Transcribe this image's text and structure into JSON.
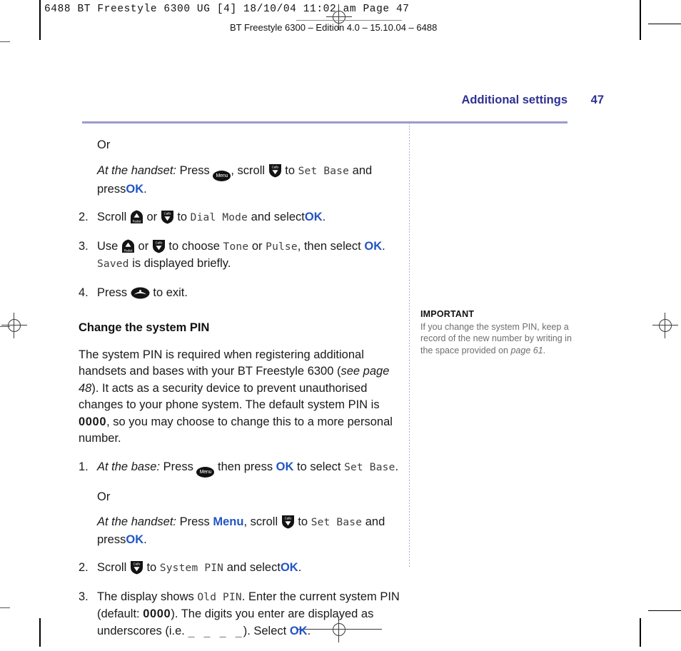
{
  "print_marks": {
    "slug": "6488 BT Freestyle 6300 UG [4]  18/10/04  11:02 am  Page 47",
    "edition_line": "BT Freestyle 6300 – Edition 4.0 – 15.10.04 – 6488"
  },
  "running_head": {
    "title": "Additional settings",
    "folio": "47"
  },
  "main": {
    "or_1": "Or",
    "handset_1": {
      "lead": "At the handset:",
      "t1": "Press",
      "icon_menu": "menu-key-icon",
      "t2": ", scroll",
      "icon_scroll_down": "scroll-down-key-icon",
      "t3": "to",
      "lcd": "Set Base",
      "t4": "and press",
      "ok": "OK",
      "t5": "."
    },
    "step_2": {
      "number": "2.",
      "t1": "Scroll",
      "icon_scroll_up": "scroll-up-key-icon",
      "t2": "or",
      "icon_scroll_down": "scroll-down-key-icon",
      "t3": "to",
      "lcd": "Dial Mode",
      "t4": "and select",
      "ok": "OK",
      "t5": "."
    },
    "step_3": {
      "number": "3.",
      "t1": "Use",
      "icon_scroll_up": "scroll-up-key-icon",
      "t2": "or",
      "icon_scroll_down": "scroll-down-key-icon",
      "t3": "to choose",
      "lcd_tone": "Tone",
      "t4": "or",
      "lcd_pulse": "Pulse",
      "t5": ", then select",
      "ok": "OK",
      "t6": ".",
      "lcd_saved": "Saved",
      "t7": "is displayed briefly."
    },
    "step_4": {
      "number": "4.",
      "t1": "Press",
      "icon_end": "end-call-key-icon",
      "t2": "to exit."
    },
    "section_heading": "Change the system PIN",
    "intro": {
      "t1": "The system PIN is required when registering additional handsets and bases with your BT Freestyle 6300 (",
      "ital": "see page 48",
      "t2": "). It acts as a security device to prevent unauthorised changes to your phone system. The default system PIN is ",
      "pin": "0000",
      "t3": ", so you may choose to change this to a more personal number."
    },
    "pin_step_1": {
      "number": "1.",
      "lead": "At the base:",
      "t1": "Press",
      "icon_menu": "menu-key-icon",
      "t2": "then press",
      "ok": "OK",
      "t3": "to select",
      "lcd": "Set Base",
      "t4": "."
    },
    "or_2": "Or",
    "handset_2": {
      "lead": "At the handset:",
      "t1": "Press",
      "menu": "Menu",
      "t2": ", scroll",
      "icon_scroll_down": "scroll-down-key-icon",
      "t3": "to",
      "lcd": "Set Base",
      "t4": "and press",
      "ok": "OK",
      "t5": "."
    },
    "pin_step_2": {
      "number": "2.",
      "t1": "Scroll",
      "icon_scroll_down": "scroll-down-key-icon",
      "t2": "to",
      "lcd": "System PIN",
      "t3": "and select",
      "ok": "OK",
      "t4": "."
    },
    "pin_step_3": {
      "number": "3.",
      "t1": "The display shows",
      "lcd_old": "Old PIN",
      "t2": ". Enter the current system PIN (default: ",
      "pin": "0000",
      "t3": "). The digits you enter are displayed as underscores (i.e. ",
      "underscores": "_ _ _ _",
      "t4": "). Select",
      "ok": "OK",
      "t5": "."
    }
  },
  "sidenote": {
    "title": "IMPORTANT",
    "body_1": "If you change the system PIN, keep a record of the new number by writing in the space provided on ",
    "body_ital": "page 61",
    "body_2": "."
  },
  "key_labels": {
    "menu": "Menu",
    "redial": "Redial",
    "calls": "Calls"
  },
  "colors": {
    "accent_blue": "#2155c4",
    "head_blue": "#2f3192",
    "rule_purple": "#9a9ccd",
    "lcd_gray": "#3d3d3d",
    "sidenote_gray": "#6e6e6e"
  }
}
